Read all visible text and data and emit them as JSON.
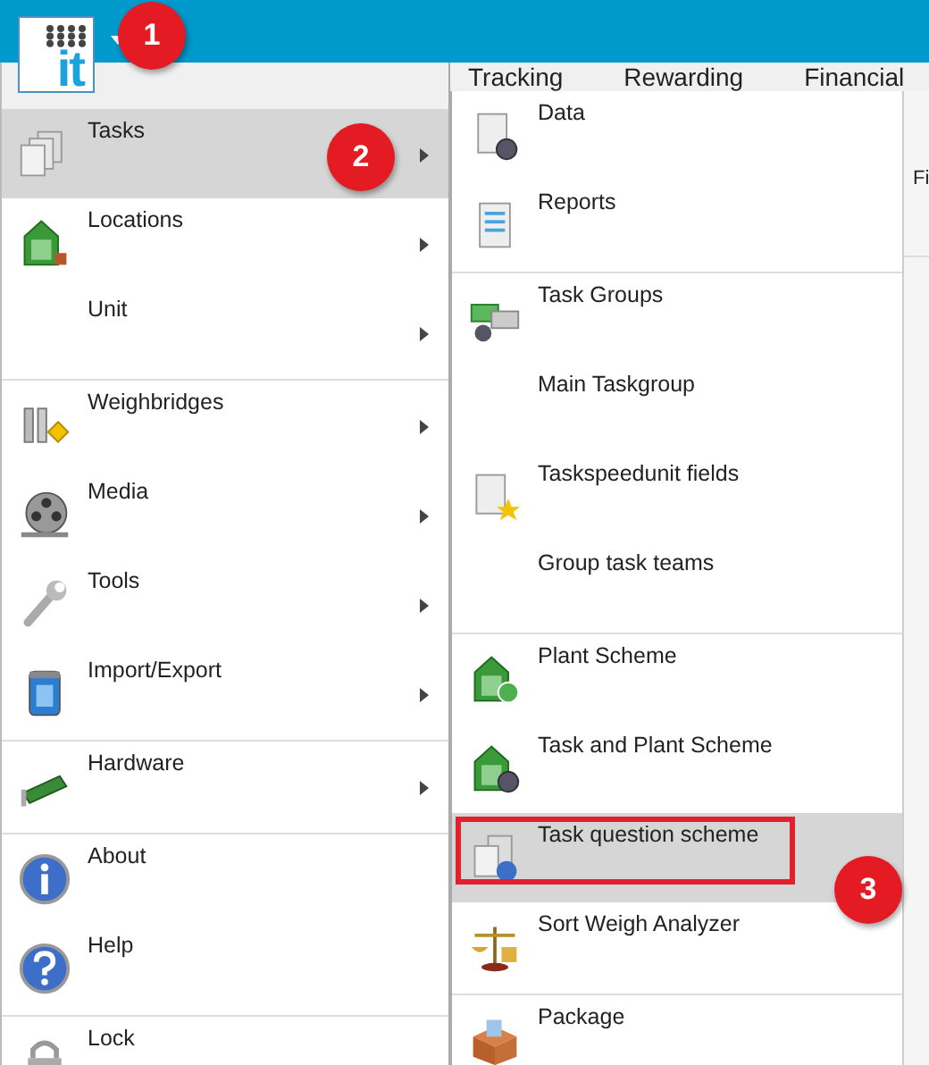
{
  "app_bar": {
    "logo_text": "it"
  },
  "callouts": [
    {
      "number": "1"
    },
    {
      "number": "2"
    },
    {
      "number": "3"
    }
  ],
  "main_menu": {
    "sections": [
      {
        "items": [
          {
            "label": "Tasks",
            "has_submenu": true,
            "selected": true
          },
          {
            "label": "Locations",
            "has_submenu": true,
            "selected": false
          },
          {
            "label": "Unit",
            "has_submenu": true,
            "selected": false
          }
        ]
      },
      {
        "items": [
          {
            "label": "Weighbridges",
            "has_submenu": true,
            "selected": false
          },
          {
            "label": "Media",
            "has_submenu": true,
            "selected": false
          },
          {
            "label": "Tools",
            "has_submenu": true,
            "selected": false
          },
          {
            "label": "Import/Export",
            "has_submenu": true,
            "selected": false
          }
        ]
      },
      {
        "items": [
          {
            "label": "Hardware",
            "has_submenu": true,
            "selected": false
          }
        ]
      },
      {
        "items": [
          {
            "label": "About",
            "has_submenu": false,
            "selected": false
          },
          {
            "label": "Help",
            "has_submenu": false,
            "selected": false
          }
        ]
      },
      {
        "items": [
          {
            "label": "Lock",
            "has_submenu": false,
            "selected": false
          }
        ]
      }
    ]
  },
  "tabs": [
    {
      "label": "Tracking"
    },
    {
      "label": "Rewarding"
    },
    {
      "label": "Financial"
    }
  ],
  "submenu": {
    "sections": [
      {
        "items": [
          {
            "label": "Data",
            "selected": false,
            "highlighted": false
          },
          {
            "label": "Reports",
            "selected": false,
            "highlighted": false
          }
        ]
      },
      {
        "items": [
          {
            "label": "Task Groups",
            "selected": false,
            "highlighted": false
          },
          {
            "label": "Main Taskgroup",
            "selected": false,
            "highlighted": false
          },
          {
            "label": "Taskspeedunit fields",
            "selected": false,
            "highlighted": false
          },
          {
            "label": "Group task teams",
            "selected": false,
            "highlighted": false
          }
        ]
      },
      {
        "items": [
          {
            "label": "Plant Scheme",
            "selected": false,
            "highlighted": false
          },
          {
            "label": "Task and Plant Scheme",
            "selected": false,
            "highlighted": false
          },
          {
            "label": "Task question scheme",
            "selected": true,
            "highlighted": true
          },
          {
            "label": "Sort Weigh Analyzer",
            "selected": false,
            "highlighted": false
          }
        ]
      },
      {
        "items": [
          {
            "label": "Package",
            "selected": false,
            "highlighted": false
          }
        ]
      }
    ]
  },
  "background": {
    "text": "Fi"
  }
}
